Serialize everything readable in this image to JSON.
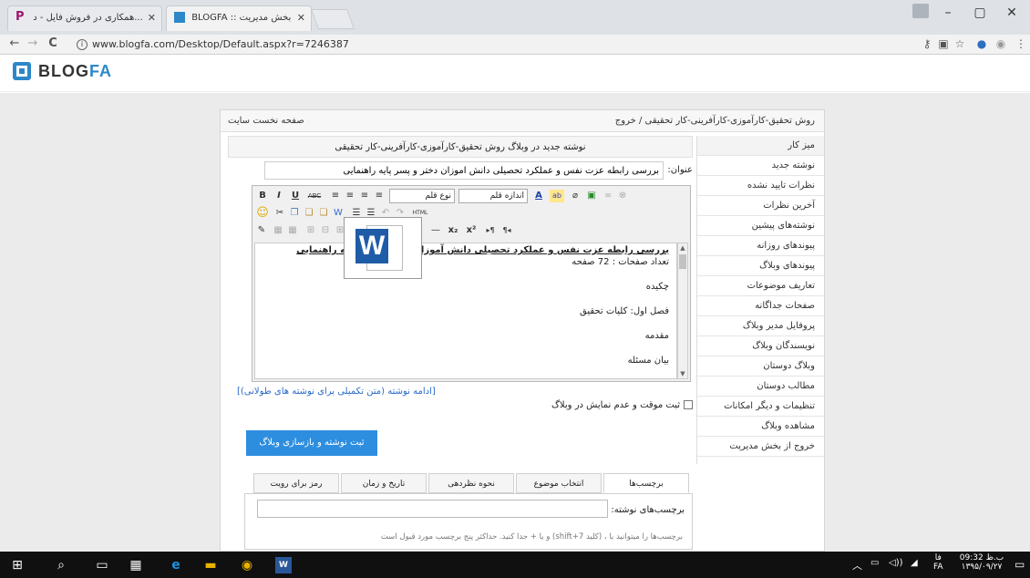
{
  "browser": {
    "tabs": [
      {
        "title": "همکاری در فروش فایل - د..."
      },
      {
        "title": "BLOGFA :: بخش مدیریت"
      }
    ],
    "url": "www.blogfa.com/Desktop/Default.aspx?r=7246387",
    "nav": {
      "back": "←",
      "forward": "→",
      "reload": "C"
    },
    "window_controls": {
      "minimize": "–",
      "maximize": "▢",
      "close": "✕"
    }
  },
  "brand": {
    "blog": "BLOG",
    "fa": "FA"
  },
  "topbar": {
    "home_link": "صفحه نخست سایت",
    "breadcrumb": "روش تحقیق-کارآموزی-کارآفرینی-کار تحقیقی / خروج"
  },
  "sidebar": {
    "items": [
      {
        "label": "میز کار"
      },
      {
        "label": "نوشته جدید"
      },
      {
        "label": "نظرات تایید نشده"
      },
      {
        "label": "آخرین نظرات"
      },
      {
        "label": "نوشته‌های پیشین"
      },
      {
        "label": "پیوندهای روزانه"
      },
      {
        "label": "پیوندهای وبلاگ"
      },
      {
        "label": "تعاریف موضوعات"
      },
      {
        "label": "صفحات جداگانه"
      },
      {
        "label": "پروفایل مدیر وبلاگ"
      },
      {
        "label": "نویسندگان وبلاگ"
      },
      {
        "label": "وبلاگ دوستان"
      },
      {
        "label": "مطالب دوستان"
      },
      {
        "label": "تنظیمات و دیگر امکانات"
      },
      {
        "label": "مشاهده وبلاگ"
      },
      {
        "label": "خروج از بخش مدیریت"
      }
    ]
  },
  "post": {
    "heading": "نوشته جدید در وبلاگ روش تحقیق-کارآموزی-کارآفرینی-کار تحقیقی",
    "title_label": "عنوان:",
    "title_value": "بررسی رابطه عزت نفس و عملکرد تحصیلی دانش آموزان دختر و پسر پایه راهنمایی",
    "toolbar": {
      "bold": "B",
      "italic": "I",
      "underline": "U",
      "strike": "ABC",
      "font_family": "نوع قلم",
      "font_size": "اندازه قلم",
      "text_color": "A",
      "highlight": "ab",
      "html": "HTML",
      "subscript": "x₂",
      "superscript": "x²"
    },
    "content": {
      "title": "بررسی رابطه عزت نفس و عملکرد تحصیلی دانش آموزان دختر و پسر پایه راهنمایی",
      "pages": "تعداد صفحات : 72 صفحه",
      "abstract": "چکیده",
      "chapter1": "فصل اول: کلیات تحقیق",
      "intro": "مقدمه",
      "problem": "بیان مسئله"
    },
    "more_link": "[ادامه نوشته (متن تکمیلی برای نوشته های طولانی)]",
    "draft_label": "ثبت موقت و عدم نمایش در وبلاگ",
    "save_button": "ثبت نوشته و بازسازی وبلاگ"
  },
  "tabs": [
    {
      "label": "برچسب‌ها"
    },
    {
      "label": "انتخاب موضوع"
    },
    {
      "label": "نحوه نظردهی"
    },
    {
      "label": "تاریخ و زمان"
    },
    {
      "label": "رمز برای رویت"
    }
  ],
  "tags": {
    "label": "برچسب‌های نوشته:",
    "hint": "برچسب‌ها را میتوانید با ، (کلید shift+7) و یا + جدا کنید. حداکثر پنج برچسب مورد قبول است"
  },
  "taskbar": {
    "time": "09:32 ب.ظ",
    "date": "۱۳۹۵/۰۹/۲۷",
    "lang": "FA",
    "lang_label": "فا"
  },
  "colors": {
    "accent": "#2d8ee0",
    "brand": "#2d87c8",
    "link": "#2a6ac8"
  }
}
